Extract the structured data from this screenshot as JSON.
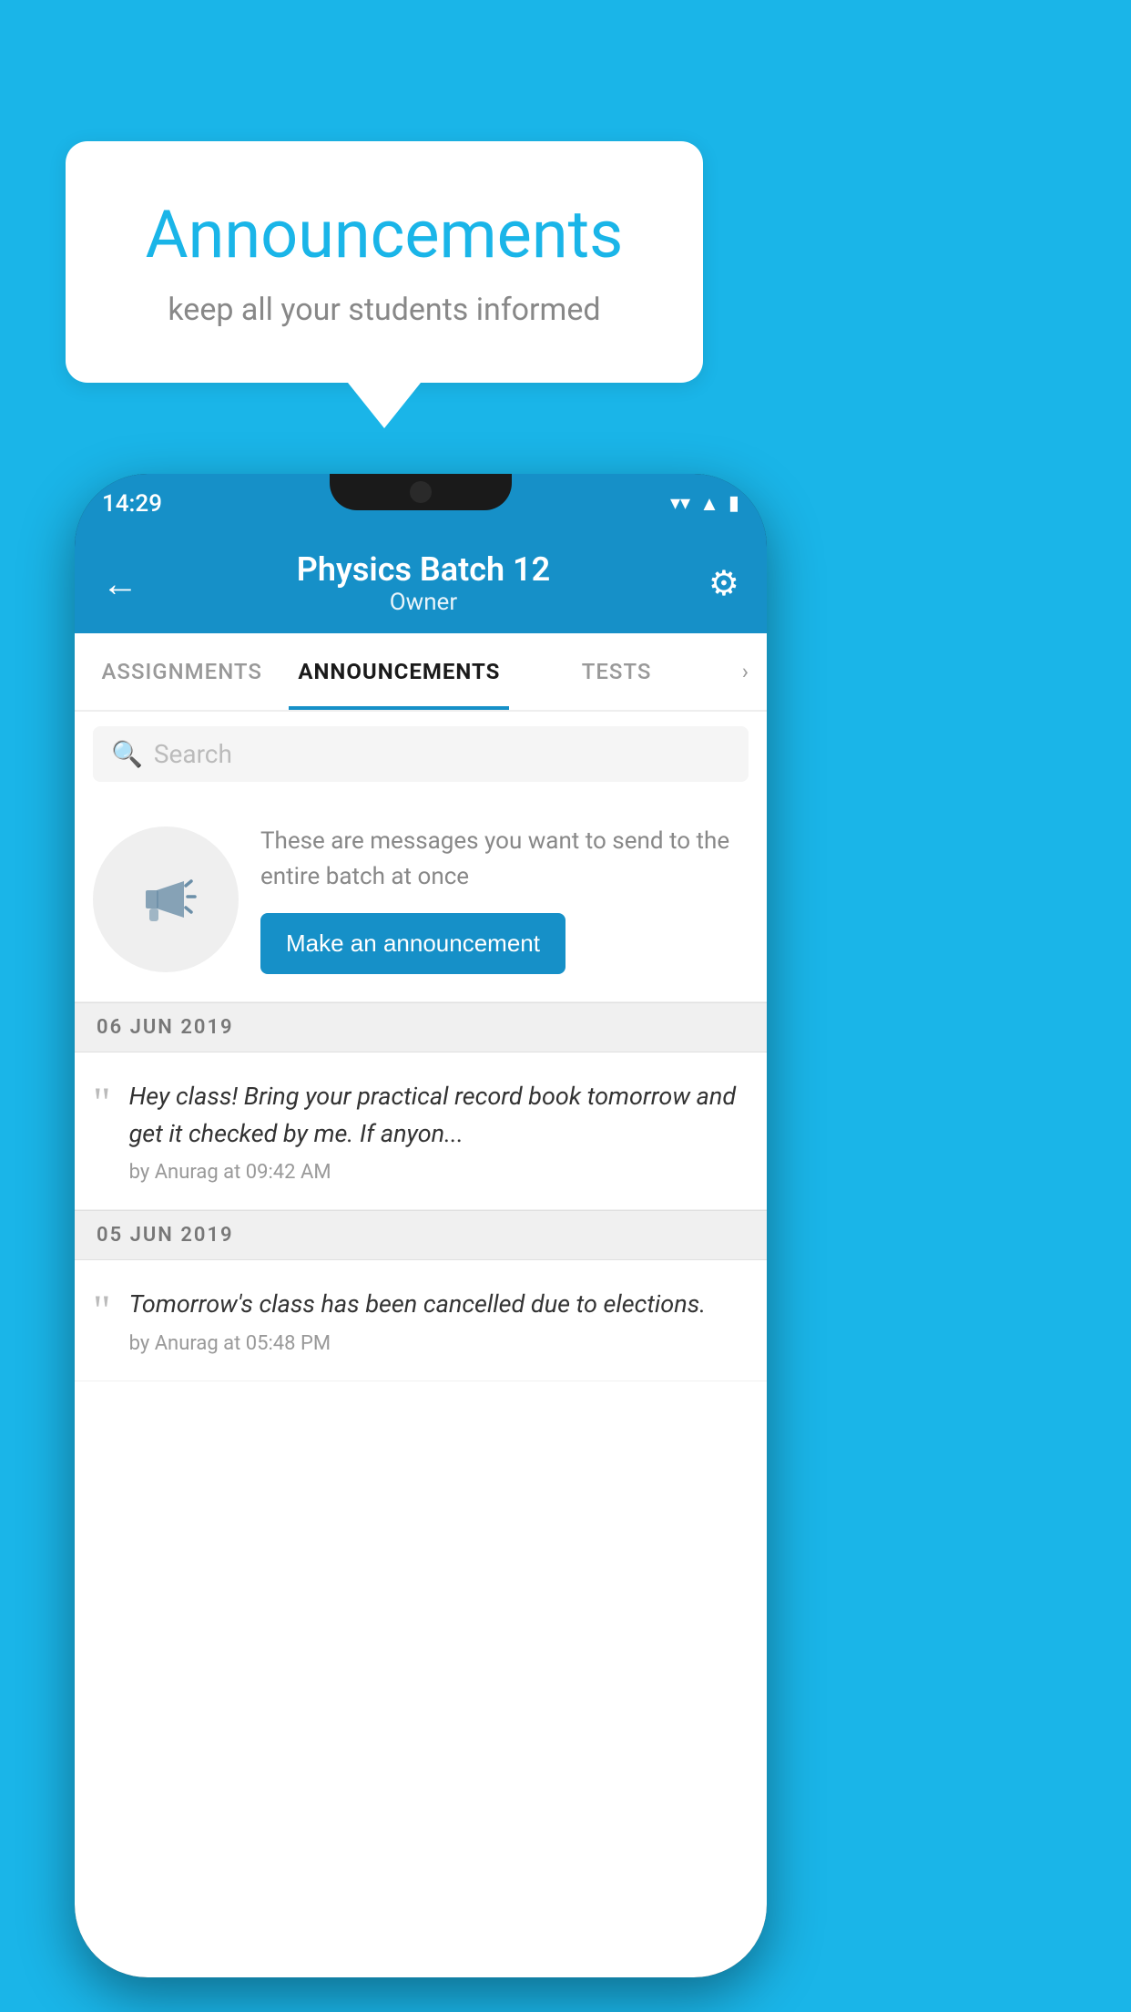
{
  "background_color": "#1AB5E8",
  "speech_bubble": {
    "title": "Announcements",
    "subtitle": "keep all your students informed"
  },
  "phone": {
    "status_bar": {
      "time": "14:29",
      "wifi": "▼",
      "signal": "▲",
      "battery": "▮"
    },
    "header": {
      "title": "Physics Batch 12",
      "subtitle": "Owner",
      "back_label": "←",
      "settings_label": "⚙"
    },
    "tabs": [
      {
        "label": "ASSIGNMENTS",
        "active": false
      },
      {
        "label": "ANNOUNCEMENTS",
        "active": true
      },
      {
        "label": "TESTS",
        "active": false
      }
    ],
    "search": {
      "placeholder": "Search"
    },
    "announcement_intro": {
      "description": "These are messages you want to send to the entire batch at once",
      "button_label": "Make an announcement"
    },
    "announcements": [
      {
        "date": "06  JUN  2019",
        "text": "Hey class! Bring your practical record book tomorrow and get it checked by me. If anyon...",
        "meta": "by Anurag at 09:42 AM"
      },
      {
        "date": "05  JUN  2019",
        "text": "Tomorrow's class has been cancelled due to elections.",
        "meta": "by Anurag at 05:48 PM"
      }
    ]
  }
}
